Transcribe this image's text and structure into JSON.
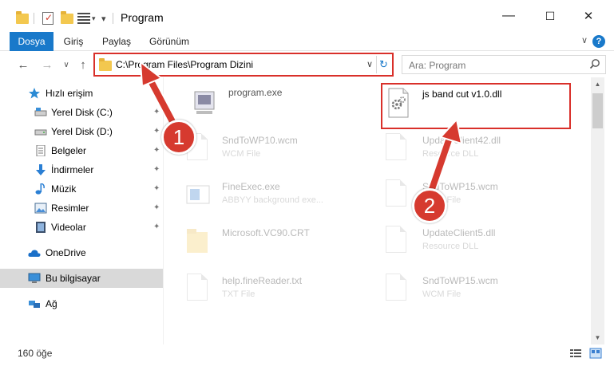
{
  "window": {
    "title": "Program",
    "controls": {
      "minimize": "—",
      "maximize": "☐",
      "close": "✕"
    }
  },
  "ribbon": {
    "tabs": [
      {
        "label": "Dosya",
        "active": true
      },
      {
        "label": "Giriş"
      },
      {
        "label": "Paylaş"
      },
      {
        "label": "Görünüm"
      }
    ],
    "help": "?",
    "expand": "∨"
  },
  "nav": {
    "back": "←",
    "forward": "→",
    "recent": "∨",
    "up": "↑",
    "address": "C:\\Program Files\\Program Dizini",
    "address_dropdown": "∨",
    "refresh": "↻",
    "search_placeholder": "Ara: Program"
  },
  "sidebar": {
    "items": [
      {
        "label": "Hızlı erişim",
        "icon": "star-icon",
        "pinned": false
      },
      {
        "label": "Yerel Disk (C:)",
        "icon": "drive-icon",
        "pinned": true
      },
      {
        "label": "Yerel Disk (D:)",
        "icon": "drive-icon",
        "pinned": true
      },
      {
        "label": "Belgeler",
        "icon": "documents-icon",
        "pinned": true
      },
      {
        "label": "İndirmeler",
        "icon": "download-icon",
        "pinned": true
      },
      {
        "label": "Müzik",
        "icon": "music-icon",
        "pinned": true
      },
      {
        "label": "Resimler",
        "icon": "pictures-icon",
        "pinned": true
      },
      {
        "label": "Videolar",
        "icon": "videos-icon",
        "pinned": true
      },
      {
        "label": "OneDrive",
        "icon": "cloud-icon",
        "pinned": false
      },
      {
        "label": "Bu bilgisayar",
        "icon": "computer-icon",
        "pinned": false,
        "selected": true
      },
      {
        "label": "Ağ",
        "icon": "network-icon",
        "pinned": false
      }
    ],
    "pin_glyph": "📌"
  },
  "files": [
    {
      "name": "program.exe",
      "type": ""
    },
    {
      "name": "js band cut v1.0.dll",
      "type": ""
    },
    {
      "name": "SndToWP10.wcm",
      "type": "WCM File"
    },
    {
      "name": "UpdateClient42.dll",
      "type": "Resource DLL"
    },
    {
      "name": "FineExec.exe",
      "type": "ABBYY background exe..."
    },
    {
      "name": "SndToWP15.wcm",
      "type": "WCM File"
    },
    {
      "name": "Microsoft.VC90.CRT",
      "type": ""
    },
    {
      "name": "UpdateClient5.dll",
      "type": "Resource DLL"
    },
    {
      "name": "help.fineReader.txt",
      "type": "TXT File"
    },
    {
      "name": "SndToWP15.wcm",
      "type": "WCM File"
    }
  ],
  "status": {
    "item_count": "160 öğe"
  },
  "annotations": {
    "badge1": "1",
    "badge2": "2",
    "color": "#d63a2f"
  }
}
